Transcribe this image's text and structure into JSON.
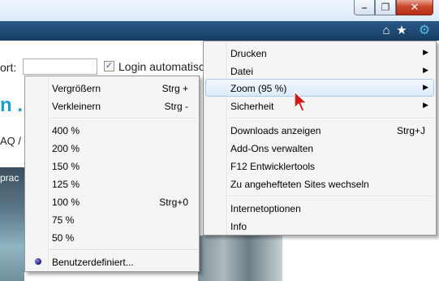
{
  "window": {
    "minimize_glyph": "–",
    "maximize_glyph": "❐",
    "close_glyph": "✕"
  },
  "toolbar": {
    "icons": [
      "home-icon",
      "favorites-star-icon",
      "tools-gear-icon"
    ]
  },
  "page": {
    "password_label": "ort:",
    "password_value": "",
    "login_checked": true,
    "login_label": "Login automatisc",
    "big_letter": "n .",
    "faq_text": "AQ /",
    "hero_text": "prac"
  },
  "main_menu": {
    "items": [
      {
        "label": "Drucken",
        "has_submenu": true
      },
      {
        "label": "Datei",
        "has_submenu": true
      },
      {
        "label": "Zoom (95 %)",
        "has_submenu": true,
        "highlighted": true
      },
      {
        "label": "Sicherheit",
        "has_submenu": true
      },
      {
        "label": "Downloads anzeigen",
        "shortcut": "Strg+J"
      },
      {
        "label": "Add-Ons verwalten"
      },
      {
        "label": "F12 Entwicklertools"
      },
      {
        "label": "Zu angehefteten Sites wechseln"
      },
      {
        "label": "Internetoptionen"
      },
      {
        "label": "Info"
      }
    ]
  },
  "zoom_menu": {
    "items": [
      {
        "label": "Vergrößern",
        "shortcut": "Strg +"
      },
      {
        "label": "Verkleinern",
        "shortcut": "Strg -"
      },
      {
        "label": "400 %"
      },
      {
        "label": "200 %"
      },
      {
        "label": "150 %"
      },
      {
        "label": "125 %"
      },
      {
        "label": "100 %",
        "shortcut": "Strg+0"
      },
      {
        "label": "75 %"
      },
      {
        "label": "50 %"
      },
      {
        "label": "Benutzerdefiniert...",
        "selected": true
      }
    ]
  },
  "colors": {
    "toolbar": "#1e4a73",
    "gear_icon": "#59b9ec",
    "menu_bg": "#f5f5f5",
    "highlight_border": "#a8c9f0",
    "link_blue": "#1b9fd8"
  }
}
